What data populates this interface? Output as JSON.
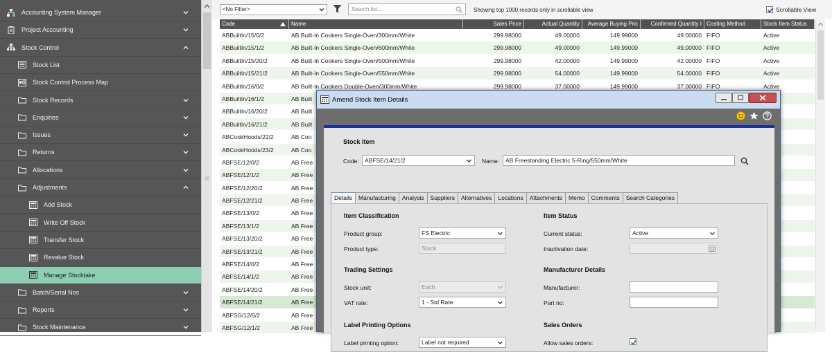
{
  "sidebar": {
    "items": [
      {
        "label": "Accounting System Manager",
        "icon": "org-chart-icon",
        "chevron": "down"
      },
      {
        "label": "Project Accounting",
        "icon": "clipboard-icon",
        "chevron": "down"
      },
      {
        "label": "Stock Control",
        "icon": "hierarchy-icon",
        "chevron": "up"
      },
      {
        "label": "Stock List",
        "icon": "list-icon",
        "chevron": ""
      },
      {
        "label": "Stock Control Process Map",
        "icon": "process-map-icon",
        "chevron": ""
      },
      {
        "label": "Stock Records",
        "icon": "folder-icon",
        "chevron": "down"
      },
      {
        "label": "Enquiries",
        "icon": "folder-icon",
        "chevron": "down"
      },
      {
        "label": "Issues",
        "icon": "folder-icon",
        "chevron": "down"
      },
      {
        "label": "Returns",
        "icon": "folder-icon",
        "chevron": "down"
      },
      {
        "label": "Allocations",
        "icon": "folder-icon",
        "chevron": "down"
      },
      {
        "label": "Adjustments",
        "icon": "folder-icon",
        "chevron": "up"
      },
      {
        "label": "Add Stock",
        "icon": "calculator-icon",
        "chevron": ""
      },
      {
        "label": "Write Off Stock",
        "icon": "calculator-icon",
        "chevron": ""
      },
      {
        "label": "Transfer Stock",
        "icon": "calculator-icon",
        "chevron": ""
      },
      {
        "label": "Revalue Stock",
        "icon": "calculator-icon",
        "chevron": ""
      },
      {
        "label": "Manage Stocktake",
        "icon": "calculator-icon",
        "chevron": ""
      },
      {
        "label": "Batch/Serial Nos",
        "icon": "folder-icon",
        "chevron": "down"
      },
      {
        "label": "Reports",
        "icon": "folder-icon",
        "chevron": "down"
      },
      {
        "label": "Stock Maintenance",
        "icon": "folder-icon",
        "chevron": "down"
      }
    ],
    "active_label": "Manage Stocktake"
  },
  "toolbar": {
    "filter_value": "<No Filter>",
    "search_placeholder": "Search list...",
    "showing_text": "Showing top 1000 records only in scrollable view",
    "scrollable_view_label": "Scrollable View",
    "scrollable_view_checked": true
  },
  "grid": {
    "columns": [
      "Code",
      "Name",
      "Sales Price",
      "Actual Quantity",
      "Average Buying Pric",
      "Confirmed Quantity I",
      "Costing Method",
      "Stock Item Status"
    ],
    "rows": [
      [
        "ABBuiltIn/15/0/2",
        "AB Built-In Cookers Single-Oven/300mm/White",
        "299.98000",
        "49.00000",
        "149.99000",
        "49.00000",
        "FIFO",
        "Active"
      ],
      [
        "ABBuiltIn/15/1/2",
        "AB Built-In Cookers Single-Oven/600mm/White",
        "299.98000",
        "49.00000",
        "149.99000",
        "49.00000",
        "FIFO",
        "Active"
      ],
      [
        "ABBuiltIn/15/20/2",
        "AB Built-In Cookers Single-Oven/500mm/White",
        "299.98000",
        "42.00000",
        "149.99000",
        "42.00000",
        "FIFO",
        "Active"
      ],
      [
        "ABBuiltIn/15/21/2",
        "AB Built-In Cookers Single-Oven/550mm/White",
        "299.98000",
        "54.00000",
        "149.99000",
        "54.00000",
        "FIFO",
        "Active"
      ],
      [
        "ABBuiltIn/16/0/2",
        "AB Built-In Cookers Double-Oven/300mm/White",
        "299.98000",
        "37.00000",
        "149.99000",
        "37.00000",
        "FIFO",
        "Active"
      ],
      [
        "ABBuiltIn/16/1/2",
        "AB Built",
        "",
        "",
        "",
        "",
        "",
        ""
      ],
      [
        "ABBuiltIn/16/20/2",
        "AB Built",
        "",
        "",
        "",
        "",
        "",
        ""
      ],
      [
        "ABBuiltIn/16/21/2",
        "AB Built",
        "",
        "",
        "",
        "",
        "",
        ""
      ],
      [
        "ABCookHoods/22/2",
        "AB Coo",
        "",
        "",
        "",
        "",
        "",
        ""
      ],
      [
        "ABCookHoods/23/2",
        "AB Coo",
        "",
        "",
        "",
        "",
        "",
        ""
      ],
      [
        "ABFSE/12/0/2",
        "AB Free",
        "",
        "",
        "",
        "",
        "",
        ""
      ],
      [
        "ABFSE/12/1/2",
        "AB Free",
        "",
        "",
        "",
        "",
        "",
        ""
      ],
      [
        "ABFSE/12/20/2",
        "AB Free",
        "",
        "",
        "",
        "",
        "",
        ""
      ],
      [
        "ABFSE/12/21/2",
        "AB Free",
        "",
        "",
        "",
        "",
        "",
        ""
      ],
      [
        "ABFSE/13/0/2",
        "AB Free",
        "",
        "",
        "",
        "",
        "",
        ""
      ],
      [
        "ABFSE/13/1/2",
        "AB Free",
        "",
        "",
        "",
        "",
        "",
        ""
      ],
      [
        "ABFSE/13/20/2",
        "AB Free",
        "",
        "",
        "",
        "",
        "",
        ""
      ],
      [
        "ABFSE/13/21/2",
        "AB Free",
        "",
        "",
        "",
        "",
        "",
        ""
      ],
      [
        "ABFSE/14/0/2",
        "AB Free",
        "",
        "",
        "",
        "",
        "",
        ""
      ],
      [
        "ABFSE/14/1/2",
        "AB Free",
        "",
        "",
        "",
        "",
        "",
        ""
      ],
      [
        "ABFSE/14/20/2",
        "AB Free",
        "",
        "",
        "",
        "",
        "",
        ""
      ],
      [
        "ABFSE/14/21/2",
        "AB Free",
        "",
        "",
        "",
        "",
        "",
        ""
      ],
      [
        "ABFSG/12/0/2",
        "AB Free",
        "",
        "",
        "",
        "",
        "",
        ""
      ],
      [
        "ABFSG/12/1/2",
        "AB Free",
        "",
        "",
        "",
        "",
        "",
        ""
      ]
    ],
    "selected_row": 21
  },
  "dialog": {
    "title": "Amend Stock Item Details",
    "section_title": "Stock Item",
    "code_label": "Code:",
    "code_value": "ABFSE/14/21/2",
    "name_label": "Name:",
    "name_value": "AB Freestanding Electric 5-Ring/550mm/White",
    "tabs": [
      "Details",
      "Manufacturing",
      "Analysis",
      "Suppliers",
      "Alternatives",
      "Locations",
      "Attachments",
      "Memo",
      "Comments",
      "Search Categories"
    ],
    "active_tab": "Details",
    "item_classification": {
      "heading": "Item Classification",
      "product_group_label": "Product group:",
      "product_group_value": "FS Electric",
      "product_type_label": "Product type:",
      "product_type_value": "Stock"
    },
    "item_status": {
      "heading": "Item Status",
      "current_status_label": "Current status:",
      "current_status_value": "Active",
      "inactivation_date_label": "Inactivation date:",
      "inactivation_date_value": ""
    },
    "trading_settings": {
      "heading": "Trading Settings",
      "stock_unit_label": "Stock unit:",
      "stock_unit_value": "Each",
      "vat_rate_label": "VAT rate:",
      "vat_rate_value": "1 - Std Rate"
    },
    "manufacturer_details": {
      "heading": "Manufacturer Details",
      "manufacturer_label": "Manufacturer:",
      "manufacturer_value": "",
      "part_no_label": "Part no:",
      "part_no_value": ""
    },
    "label_printing": {
      "heading": "Label Printing Options",
      "option_label": "Label printing option:",
      "option_value": "Label not required"
    },
    "sales_orders": {
      "heading": "Sales Orders",
      "allow_label": "Allow sales orders:",
      "allow_checked": true
    }
  },
  "colors": {
    "sidebar_bg": "#565656",
    "sidebar_active": "#8ecfb4",
    "grid_header": "#525252",
    "row_alt": "#eef5ec",
    "dialog_accent": "#1a3494",
    "title_bar": "#c9dcf0"
  }
}
